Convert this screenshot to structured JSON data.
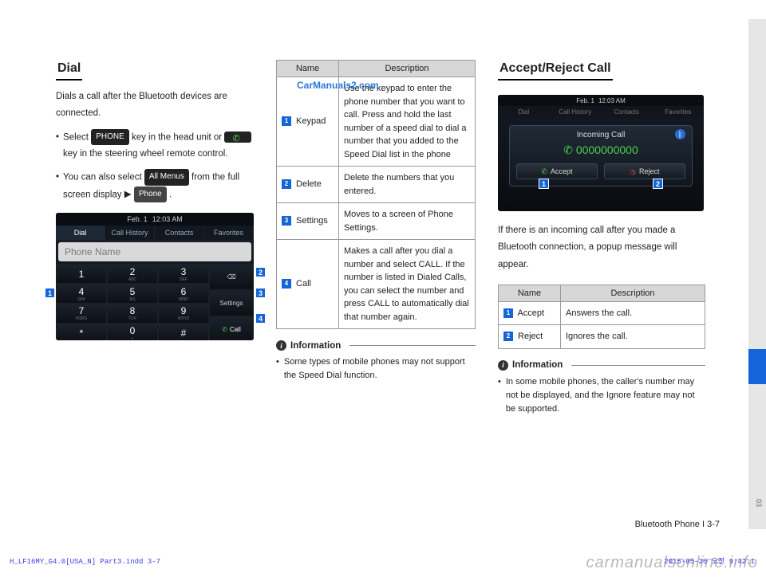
{
  "watermarks": {
    "top": "CarManuals2.com",
    "bottom": "carmanualsonline.info",
    "indd_left": "H_LF16MY_G4.0[USA_N] Part3.indd   3-7",
    "indd_right": "2015-05-26   오전 9:42:1"
  },
  "page_footer": "Bluetooth Phone I 3-7",
  "side_tab": "03",
  "dial": {
    "title": "Dial",
    "intro": "Dials a call after the Bluetooth devices are connected.",
    "b1_a": "Select ",
    "b1_btn_phone": "PHONE",
    "b1_b": " key in the head unit or ",
    "b1_c": " key in the steering wheel remote control.",
    "b2_a": "You can also select ",
    "b2_btn_allmenus": "All Menus",
    "b2_b": " from the full screen display ",
    "tri": "▶",
    "b2_btn_phone2": "Phone",
    "b2_c": ".",
    "screen": {
      "date": "Feb.  1",
      "time": "12:03 AM",
      "tabs": [
        "Dial",
        "Call History",
        "Contacts",
        "Favorites"
      ],
      "phone_name": "Phone Name",
      "side_delete": "⌫",
      "side_settings": "Settings",
      "side_call": "Call",
      "keys": [
        {
          "n": "1",
          "s": ""
        },
        {
          "n": "2",
          "s": "ABC"
        },
        {
          "n": "3",
          "s": "DEF"
        },
        {
          "n": "4",
          "s": "GHI"
        },
        {
          "n": "5",
          "s": "JKL"
        },
        {
          "n": "6",
          "s": "MNO"
        },
        {
          "n": "7",
          "s": "PQRS"
        },
        {
          "n": "8",
          "s": "TUV"
        },
        {
          "n": "9",
          "s": "WXYZ"
        },
        {
          "n": "*",
          "s": ""
        },
        {
          "n": "0",
          "s": "+"
        },
        {
          "n": "#",
          "s": ""
        }
      ]
    }
  },
  "dial_table": {
    "head_name": "Name",
    "head_desc": "Description",
    "rows": [
      {
        "m": "1",
        "name": "Keypad",
        "desc": "Use the keypad to enter the phone number that you want to call. Press and hold the last number of a speed dial to dial a number that you added to the Speed Dial list in the phone"
      },
      {
        "m": "2",
        "name": "Delete",
        "desc": "Delete the numbers that you entered."
      },
      {
        "m": "3",
        "name": "Settings",
        "desc": "Moves to a screen of Phone Settings."
      },
      {
        "m": "4",
        "name": "Call",
        "desc": "Makes a call after  you dial a number and select CALL. If the number is listed in Dialed Calls, you can select the number and press CALL to automatically dial that number again."
      }
    ]
  },
  "dial_info": {
    "label": "Information",
    "bullet": "Some types of mobile phones may not support the Speed Dial function."
  },
  "accept": {
    "title": "Accept/Reject Call",
    "intro": "If there is an incoming call after you made a Bluetooth connection, a popup message will appear.",
    "screen": {
      "date": "Feb.  1",
      "time": "12:03 AM",
      "tabs": [
        "Dial",
        "Call History",
        "Contacts",
        "Favorites"
      ],
      "incoming": "Incoming Call",
      "number": "0000000000",
      "accept": "Accept",
      "reject": "Reject"
    },
    "table": {
      "head_name": "Name",
      "head_desc": "Description",
      "rows": [
        {
          "m": "1",
          "name": "Accept",
          "desc": "Answers the call."
        },
        {
          "m": "2",
          "name": "Reject",
          "desc": "Ignores the call."
        }
      ]
    },
    "info": {
      "label": "Information",
      "bullet": "In some mobile phones, the caller's number may not be displayed, and the Ignore feature may not be supported."
    }
  }
}
